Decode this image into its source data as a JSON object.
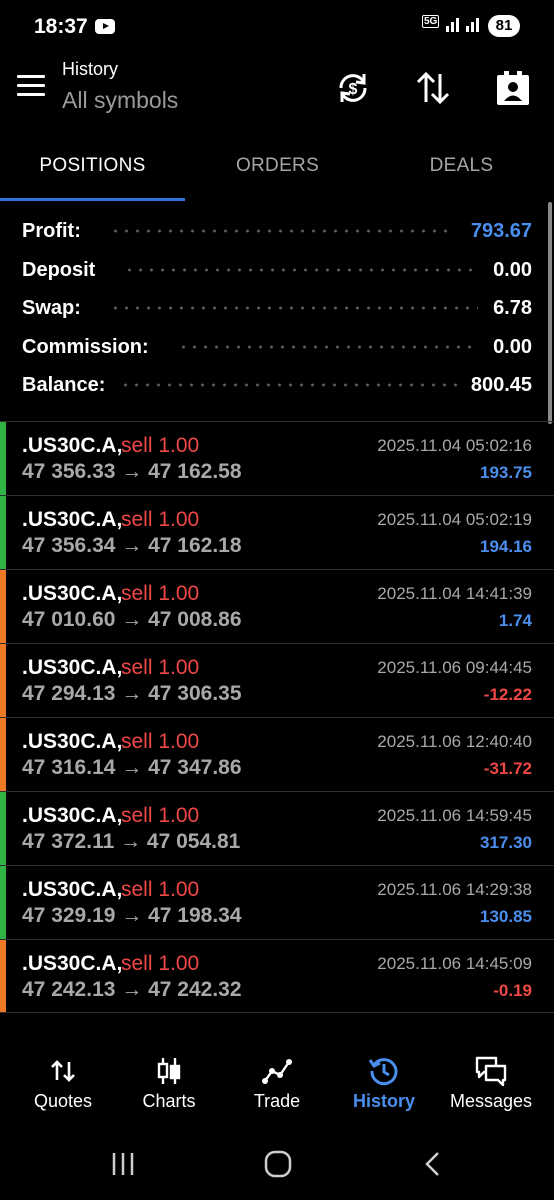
{
  "status_bar": {
    "time": "18:37",
    "network": "5G",
    "battery": "81"
  },
  "header": {
    "title": "History",
    "subtitle": "All symbols"
  },
  "tabs": [
    {
      "label": "POSITIONS",
      "active": true
    },
    {
      "label": "ORDERS",
      "active": false
    },
    {
      "label": "DEALS",
      "active": false
    }
  ],
  "summary": {
    "profit": {
      "label": "Profit:",
      "value": "793.67"
    },
    "deposit": {
      "label": "Deposit",
      "value": "0.00"
    },
    "swap": {
      "label": "Swap:",
      "value": "6.78"
    },
    "commission": {
      "label": "Commission:",
      "value": "0.00"
    },
    "balance": {
      "label": "Balance:",
      "value": "800.45"
    }
  },
  "deals": [
    {
      "symbol": ".US30C.A,",
      "side": "sell 1.00",
      "prices": "47 356.33 → 47 162.58",
      "time": "2025.11.04 05:02:16",
      "profit": "193.75",
      "positive": true
    },
    {
      "symbol": ".US30C.A,",
      "side": "sell 1.00",
      "prices": "47 356.34 → 47 162.18",
      "time": "2025.11.04 05:02:19",
      "profit": "194.16",
      "positive": true
    },
    {
      "symbol": ".US30C.A,",
      "side": "sell 1.00",
      "prices": "47 010.60 → 47 008.86",
      "time": "2025.11.04 14:41:39",
      "profit": "1.74",
      "positive": false
    },
    {
      "symbol": ".US30C.A,",
      "side": "sell 1.00",
      "prices": "47 294.13 → 47 306.35",
      "time": "2025.11.06 09:44:45",
      "profit": "-12.22",
      "positive": false
    },
    {
      "symbol": ".US30C.A,",
      "side": "sell 1.00",
      "prices": "47 316.14 → 47 347.86",
      "time": "2025.11.06 12:40:40",
      "profit": "-31.72",
      "positive": false
    },
    {
      "symbol": ".US30C.A,",
      "side": "sell 1.00",
      "prices": "47 372.11 → 47 054.81",
      "time": "2025.11.06 14:59:45",
      "profit": "317.30",
      "positive": true
    },
    {
      "symbol": ".US30C.A,",
      "side": "sell 1.00",
      "prices": "47 329.19 → 47 198.34",
      "time": "2025.11.06 14:29:38",
      "profit": "130.85",
      "positive": true
    },
    {
      "symbol": ".US30C.A,",
      "side": "sell 1.00",
      "prices": "47 242.13 → 47 242.32",
      "time": "2025.11.06 14:45:09",
      "profit": "-0.19",
      "positive": false
    }
  ],
  "bottom_nav": [
    {
      "label": "Quotes",
      "icon": "quotes-icon",
      "active": false
    },
    {
      "label": "Charts",
      "icon": "charts-icon",
      "active": false
    },
    {
      "label": "Trade",
      "icon": "trade-icon",
      "active": false
    },
    {
      "label": "History",
      "icon": "history-icon",
      "active": true
    },
    {
      "label": "Messages",
      "icon": "messages-icon",
      "active": false
    }
  ],
  "colors": {
    "accent": "#4b8fee",
    "tab_underline": "#2f73d8",
    "sell": "#f04747",
    "profit_positive": "#4b8fee",
    "profit_negative": "#f04747",
    "bar_green": "#2fb344",
    "bar_orange": "#f07a23"
  }
}
